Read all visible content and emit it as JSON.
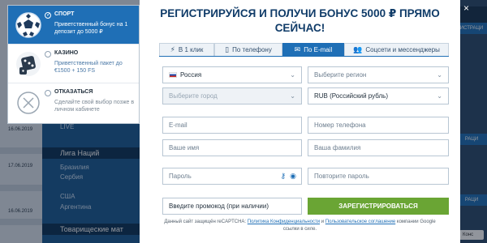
{
  "background": {
    "nav_rows": [
      "LIVE",
      "Лига Наций",
      "Бразилия",
      "Сербия",
      "США",
      "Аргентина",
      "Товарищеские мат"
    ],
    "dates": [
      "16.06.2019",
      "17.06.2019",
      "16.06.2019"
    ],
    "right_labels": [
      "ИСТРАЦИ",
      "РАЦИ",
      "РАЦИ"
    ],
    "help_label": "Конс"
  },
  "bonus_options": [
    {
      "title": "Спорт",
      "desc": "Приветственный бонус на 1 депозит до 5000 ₽",
      "icon": "soccer-ball-icon",
      "selected": true
    },
    {
      "title": "Казино",
      "desc": "Приветственный пакет до €1500 + 150 FS",
      "icon": "dice-icon",
      "selected": false
    },
    {
      "title": "Отказаться",
      "desc": "Сделайте свой выбор позже в личном кабинете",
      "icon": "cross-circle-icon",
      "selected": false
    }
  ],
  "modal": {
    "heading": "РЕГИСТРИРУЙСЯ И ПОЛУЧИ БОНУС 5000 ₽ ПРЯМО СЕЙЧАС!",
    "close_icon": "×"
  },
  "tabs": [
    {
      "label": "В 1 клик",
      "icon": "lightning-icon",
      "glyph": "⚡",
      "active": false
    },
    {
      "label": "По телефону",
      "icon": "phone-icon",
      "glyph": "▯",
      "active": false
    },
    {
      "label": "По E-mail",
      "icon": "envelope-icon",
      "glyph": "✉",
      "active": true
    },
    {
      "label": "Соцсети и мессенджеры",
      "icon": "people-icon",
      "glyph": "👥",
      "active": false
    }
  ],
  "form": {
    "country": "Россия",
    "region_placeholder": "Выберите регион",
    "city_placeholder": "Выберите город",
    "currency": "RUB (Российский рубль)",
    "email_placeholder": "E-mail",
    "phone_placeholder": "Номер телефона",
    "name_placeholder": "Ваше имя",
    "surname_placeholder": "Ваша фамилия",
    "password_placeholder": "Пароль",
    "repeat_password_placeholder": "Повторите пароль",
    "promo_placeholder": "Введите промокод (при наличии)",
    "submit_label": "ЗАРЕГИСТРИРОВАТЬСЯ"
  },
  "legal": {
    "prefix": "Данный сайт защищён reCAPTCHA:",
    "privacy_link": "Политика Конфиденциальности",
    "and": "и",
    "terms_link": "Пользовательское соглашение",
    "suffix_line1": "компании Google",
    "suffix_line2": "ссылки в силе."
  },
  "colors": {
    "accent_blue": "#1f6fb6",
    "heading_navy": "#0f3b68",
    "submit_green": "#6aa534"
  }
}
